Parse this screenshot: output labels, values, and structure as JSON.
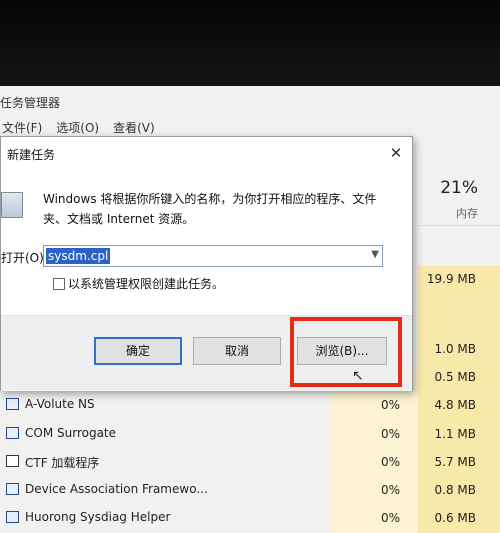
{
  "task_manager": {
    "title": "任务管理器",
    "menu": [
      "文件(F)",
      "选项(O)",
      "查看(V)"
    ],
    "memory_header": {
      "percent": "21%",
      "label": "内存"
    },
    "side_memory_values": [
      "19.9 MB",
      "1.0 MB",
      "0.5 MB"
    ],
    "processes": [
      {
        "name": "A-Volute NS",
        "cpu": "0%",
        "mem": "4.8 MB",
        "icon": "app-window-icon"
      },
      {
        "name": "COM Surrogate",
        "cpu": "0%",
        "mem": "1.1 MB",
        "icon": "app-window-icon"
      },
      {
        "name": "CTF 加载程序",
        "cpu": "0%",
        "mem": "5.7 MB",
        "icon": "pen-icon"
      },
      {
        "name": "Device Association Framewo...",
        "cpu": "0%",
        "mem": "0.8 MB",
        "icon": "app-window-icon"
      },
      {
        "name": "Huorong Sysdiag Helper",
        "cpu": "0%",
        "mem": "0.6 MB",
        "icon": "app-window-icon"
      }
    ]
  },
  "dialog": {
    "title": "新建任务",
    "close_symbol": "✕",
    "description": "Windows 将根据你所键入的名称，为你打开相应的程序、文件夹、文档或 Internet 资源。",
    "open_label": "打开(O):",
    "open_value": "sysdm.cpl",
    "admin_checkbox_label": "以系统管理权限创建此任务。",
    "admin_checkbox_checked": false,
    "ok_label": "确定",
    "cancel_label": "取消",
    "browse_label": "浏览(B)..."
  },
  "colors": {
    "highlight": "#e32b18",
    "selection": "#2b62c8",
    "memory_column": "#f7e9a9"
  }
}
